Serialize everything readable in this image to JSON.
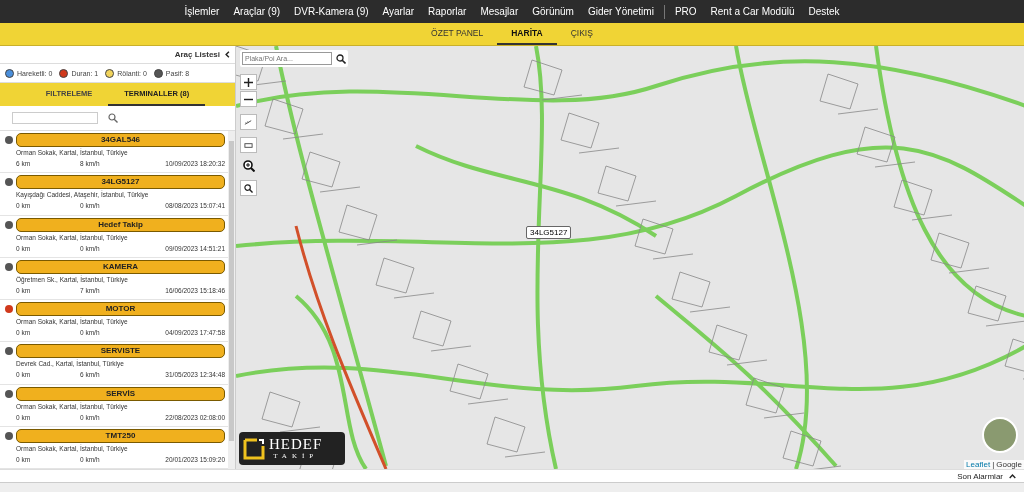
{
  "top_menu": {
    "groups": [
      [
        "İşlemler",
        "Araçlar (9)",
        "DVR-Kamera (9)",
        "Ayarlar",
        "Raporlar",
        "Mesajlar",
        "Görünüm",
        "Gider Yönetimi"
      ],
      [
        "PRO",
        "Rent a Car Modülü",
        "Destek"
      ]
    ]
  },
  "sub_nav": {
    "tabs": [
      {
        "label": "ÖZET PANEL",
        "selected": false
      },
      {
        "label": "HARİTA",
        "selected": true
      },
      {
        "label": "ÇIKIŞ",
        "selected": false
      }
    ]
  },
  "sidebar": {
    "title": "Araç Listesi",
    "legend": [
      {
        "label": "Hareketli: 0",
        "color": "#4a8fdc"
      },
      {
        "label": "Duran: 1",
        "color": "#d0391c"
      },
      {
        "label": "Rölanti: 0",
        "color": "#f2d45c"
      },
      {
        "label": "Pasif: 8",
        "color": "#555555"
      }
    ],
    "tabs": [
      {
        "label": "FILTRELEME",
        "selected": false
      },
      {
        "label": "TERMINALLER (8)",
        "selected": true
      }
    ],
    "vehicles": [
      {
        "name": "34GAL546",
        "address": "Orman Sokak, Kartal, İstanbul, Türkiye",
        "distance": "6 km",
        "speed": "8 km/h",
        "time": "10/09/2023 18:20:32",
        "color": "#555555"
      },
      {
        "name": "34LG5127",
        "address": "Kayışdağı Caddesi, Ataşehir, İstanbul, Türkiye",
        "distance": "0 km",
        "speed": "0 km/h",
        "time": "08/08/2023 15:07:41",
        "color": "#555555"
      },
      {
        "name": "Hedef Takip",
        "address": "Orman Sokak, Kartal, İstanbul, Türkiye",
        "distance": "0 km",
        "speed": "0 km/h",
        "time": "09/09/2023 14:51:21",
        "color": "#555555"
      },
      {
        "name": "KAMERA",
        "address": "Öğretmen Sk., Kartal, İstanbul, Türkiye",
        "distance": "0 km",
        "speed": "7 km/h",
        "time": "16/06/2023 15:18:46",
        "color": "#555555"
      },
      {
        "name": "MOTOR",
        "address": "Orman Sokak, Kartal, İstanbul, Türkiye",
        "distance": "0 km",
        "speed": "0 km/h",
        "time": "04/09/2023 17:47:58",
        "color": "#d0391c"
      },
      {
        "name": "SERVISTE",
        "address": "Devrek Cad., Kartal, İstanbul, Türkiye",
        "distance": "0 km",
        "speed": "6 km/h",
        "time": "31/05/2023 12:34:48",
        "color": "#555555"
      },
      {
        "name": "SERVİS",
        "address": "Orman Sokak, Kartal, İstanbul, Türkiye",
        "distance": "0 km",
        "speed": "0 km/h",
        "time": "22/08/2023 02:08:00",
        "color": "#555555"
      },
      {
        "name": "TMT250",
        "address": "Orman Sokak, Kartal, İstanbul, Türkiye",
        "distance": "0 km",
        "speed": "0 km/h",
        "time": "20/01/2023 15:09:20",
        "color": "#555555"
      }
    ]
  },
  "map": {
    "search": {
      "placeholder": "Plaka/Poi Ara..."
    },
    "marker_label": "34LG5127",
    "logo": {
      "word": "HEDEF",
      "tagline": "TAKİP"
    },
    "attribution": [
      "Leaflet",
      "|",
      "Google"
    ]
  },
  "footer": {
    "label": "Son Alarmlar"
  }
}
